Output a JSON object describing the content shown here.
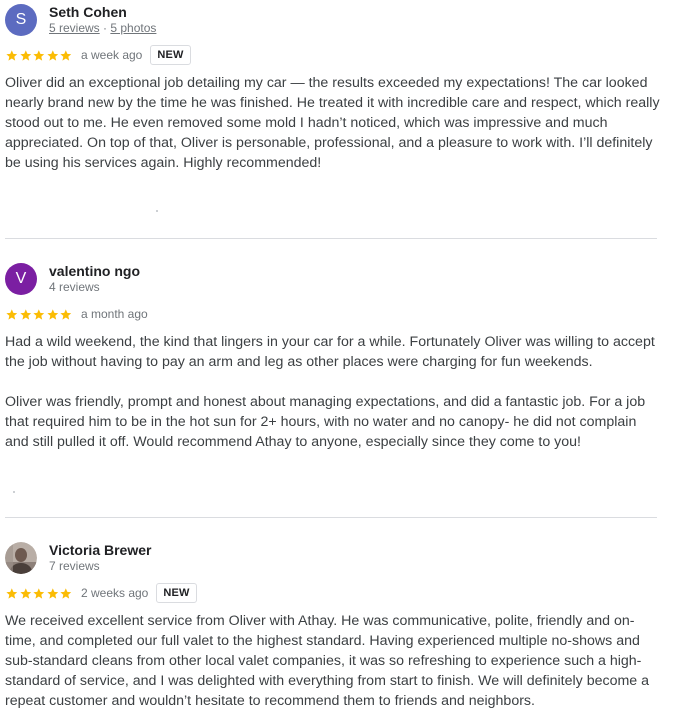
{
  "reviews": [
    {
      "avatar_letter": "S",
      "avatar_color": "#5c6bc0",
      "name": "Seth Cohen",
      "reviews_count": "5 reviews",
      "separator": "·",
      "photos_count": "5 photos",
      "rating": 5,
      "time": "a week ago",
      "badge": "NEW",
      "paragraphs": [
        "Oliver did an exceptional job detailing my car — the results exceeded my expectations! The car looked nearly brand new by the time he was finished. He treated it with incredible care and respect, which really stood out to me. He even removed some mold I hadn’t noticed, which was impressive and much appreciated. On top of that, Oliver is personable, professional, and a pleasure to work with. I’ll definitely be using his services again. Highly recommended!"
      ]
    },
    {
      "avatar_letter": "V",
      "avatar_color": "#7b1fa2",
      "name": "valentino ngo",
      "reviews_count": "4 reviews",
      "rating": 5,
      "time": "a month ago",
      "paragraphs": [
        "Had a wild weekend, the kind that lingers in your car for a while. Fortunately Oliver was willing to accept the job without having to pay an arm and leg as other places were charging for fun weekends.",
        "Oliver was friendly, prompt and honest about managing expectations, and did a fantastic job. For a job that required him to be in the hot sun for 2+ hours, with no water and no canopy- he did not complain and still pulled it off. Would recommend Athay to anyone, especially since they come to you!"
      ]
    },
    {
      "avatar_type": "photo",
      "name": "Victoria Brewer",
      "reviews_count": "7 reviews",
      "rating": 5,
      "time": "2 weeks ago",
      "badge": "NEW",
      "paragraphs": [
        "We received excellent service from Oliver with Athay. He was communicative, polite, friendly and on-time, and completed our full valet to the highest standard. Having experienced multiple no-shows and sub-standard cleans from other local valet companies, it was so refreshing to experience such a high-standard of service, and I was delighted with everything from start to finish. We will definitely become a repeat customer and wouldn’t hesitate to recommend them to friends and neighbors."
      ]
    }
  ],
  "colors": {
    "star": "#fbbc04",
    "meta": "#70757a",
    "divider": "#dadce0"
  }
}
